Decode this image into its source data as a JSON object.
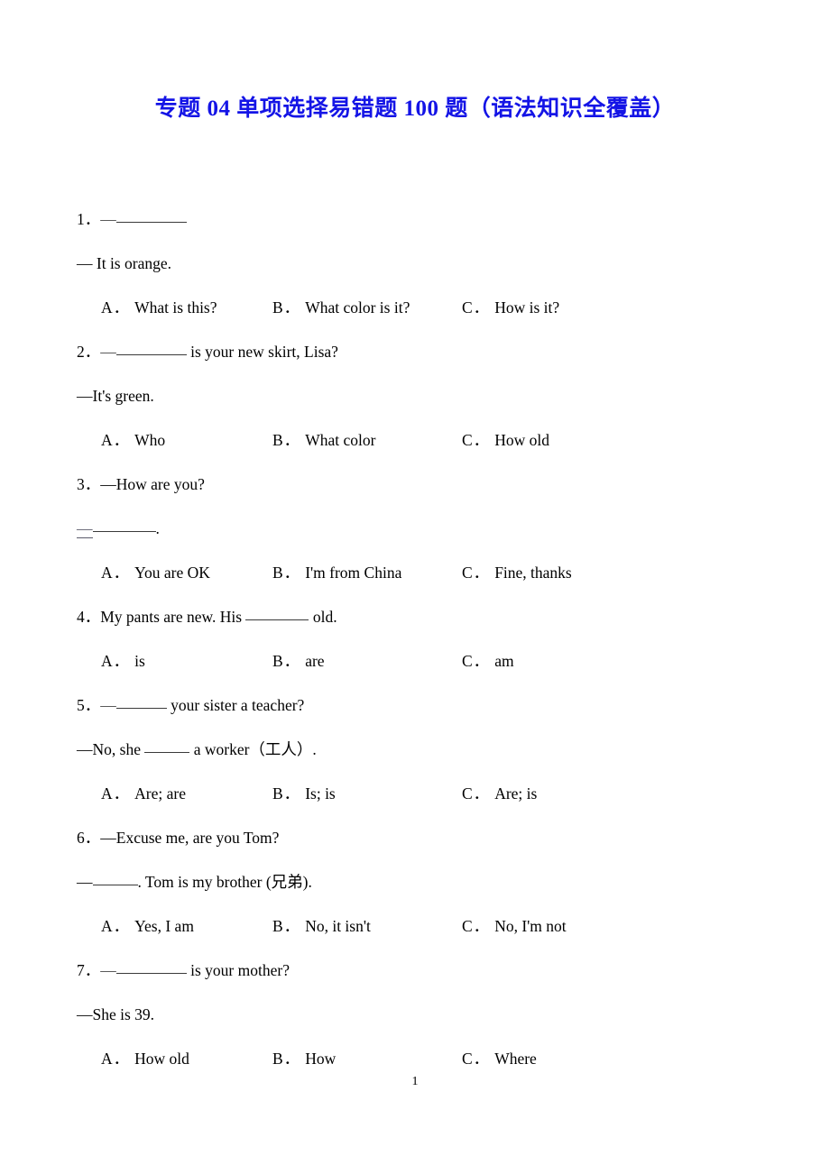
{
  "document": {
    "title": "专题 04 单项选择易错题 100 题（语法知识全覆盖）",
    "title_color": "#1414e6",
    "page_number": "1"
  },
  "questions": [
    {
      "number": "1．",
      "stem_prefix": "—",
      "stem_blank": "w8",
      "stem_suffix": "",
      "answer": "— It is orange.",
      "options": [
        {
          "key": "A．",
          "text": "What is this?"
        },
        {
          "key": "B．",
          "text": "What color is it?"
        },
        {
          "key": "C．",
          "text": "How is it?"
        }
      ]
    },
    {
      "number": "2．",
      "stem_prefix": "—",
      "stem_blank": "w8",
      "stem_suffix": " is your new skirt, Lisa?",
      "answer": "—It's green.",
      "options": [
        {
          "key": "A．",
          "text": "Who"
        },
        {
          "key": "B．",
          "text": "What color"
        },
        {
          "key": "C．",
          "text": "How old"
        }
      ]
    },
    {
      "number": "3．",
      "stem_plain": "—How are you?",
      "answer_prefix": "—",
      "answer_blank": "w7",
      "answer_suffix": ".",
      "options": [
        {
          "key": "A．",
          "text": "You are OK"
        },
        {
          "key": "B．",
          "text": "I'm from China"
        },
        {
          "key": "C．",
          "text": "Fine, thanks"
        }
      ]
    },
    {
      "number": "4．",
      "stem_prefix_plain": "My pants are new. His ",
      "stem_blank": "w7",
      "stem_suffix": " old.",
      "options": [
        {
          "key": "A．",
          "text": "is"
        },
        {
          "key": "B．",
          "text": "are"
        },
        {
          "key": "C．",
          "text": "am"
        }
      ]
    },
    {
      "number": "5．",
      "stem_prefix": "—",
      "stem_blank": "w6",
      "stem_suffix": " your sister a teacher?",
      "answer_prefix": "—No, she ",
      "answer_blank": "w5",
      "answer_suffix": " a worker（工人）.",
      "options": [
        {
          "key": "A．",
          "text": "Are; are"
        },
        {
          "key": "B．",
          "text": "Is; is"
        },
        {
          "key": "C．",
          "text": "Are; is"
        }
      ]
    },
    {
      "number": "6．",
      "stem_plain": "—Excuse me, are you Tom?",
      "answer_prefix": "—",
      "answer_blank": "w5",
      "answer_suffix": ". Tom is my brother (兄弟).",
      "options": [
        {
          "key": "A．",
          "text": "Yes, I am"
        },
        {
          "key": "B．",
          "text": "No, it isn't"
        },
        {
          "key": "C．",
          "text": "No, I'm not"
        }
      ]
    },
    {
      "number": "7．",
      "stem_prefix": "—",
      "stem_blank": "w8",
      "stem_suffix": " is your mother?",
      "answer": "—She is 39.",
      "options": [
        {
          "key": "A．",
          "text": "How old"
        },
        {
          "key": "B．",
          "text": "How"
        },
        {
          "key": "C．",
          "text": "Where"
        }
      ]
    }
  ]
}
